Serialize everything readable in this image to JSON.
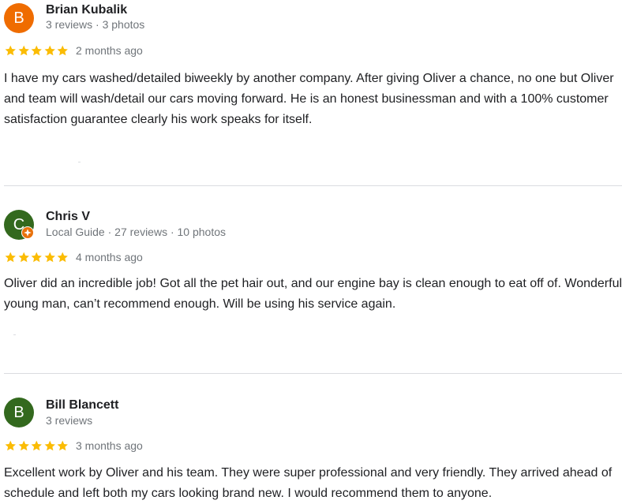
{
  "colors": {
    "star": "#fbbc04",
    "avatar_orange": "#ef6c00",
    "avatar_green_dark": "#2e6b1f",
    "avatar_green": "#33691e",
    "guide_badge": "#e8710a",
    "meta_text": "#70757a",
    "divider": "#dadce0"
  },
  "reviews": [
    {
      "avatar_letter": "B",
      "name": "Brian Kubalik",
      "meta": "3 reviews · 3 photos",
      "rating": 5,
      "date": "2 months ago",
      "text": "I have my cars washed/detailed biweekly by another company. After giving Oliver a chance, no one but Oliver and team will wash/detail our cars moving forward. He is an honest businessman and with a 100% customer satisfaction guarantee clearly his work speaks for itself."
    },
    {
      "avatar_letter": "C",
      "name": "Chris V",
      "meta": "Local Guide · 27 reviews · 10 photos",
      "rating": 5,
      "date": "4 months ago",
      "text": "Oliver did an incredible job! Got all the pet hair out, and our engine bay is clean enough to eat off of. Wonderful young man, can’t recommend enough. Will be using his service again."
    },
    {
      "avatar_letter": "B",
      "name": "Bill Blancett",
      "meta": "3 reviews",
      "rating": 5,
      "date": "3 months ago",
      "text": "Excellent work by Oliver and his team. They were super professional and very friendly. They arrived ahead of schedule and left both my cars looking brand new. I would recommend them to anyone."
    }
  ],
  "icons": {
    "star": "star-icon",
    "local_guide": "local-guide-badge-icon"
  }
}
